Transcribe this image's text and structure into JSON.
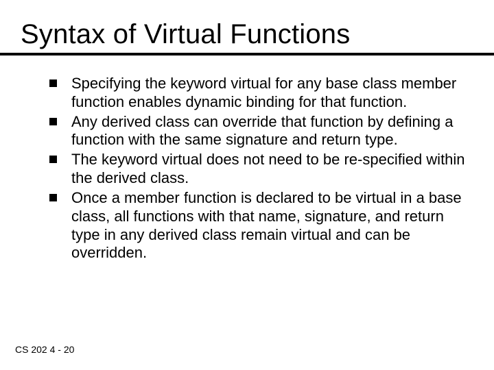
{
  "title": "Syntax of Virtual Functions",
  "bullets": [
    "Specifying the keyword virtual for any base class member function enables dynamic binding for that function.",
    "Any derived class can override that function by defining a function with the same signature and return type.",
    "The keyword virtual does not need to be re-specified within the derived class.",
    "Once a member function is declared to be virtual in a base class, all functions with that name, signature, and return type in any derived class remain virtual and can be overridden."
  ],
  "footer": "CS 202   4 - 20"
}
